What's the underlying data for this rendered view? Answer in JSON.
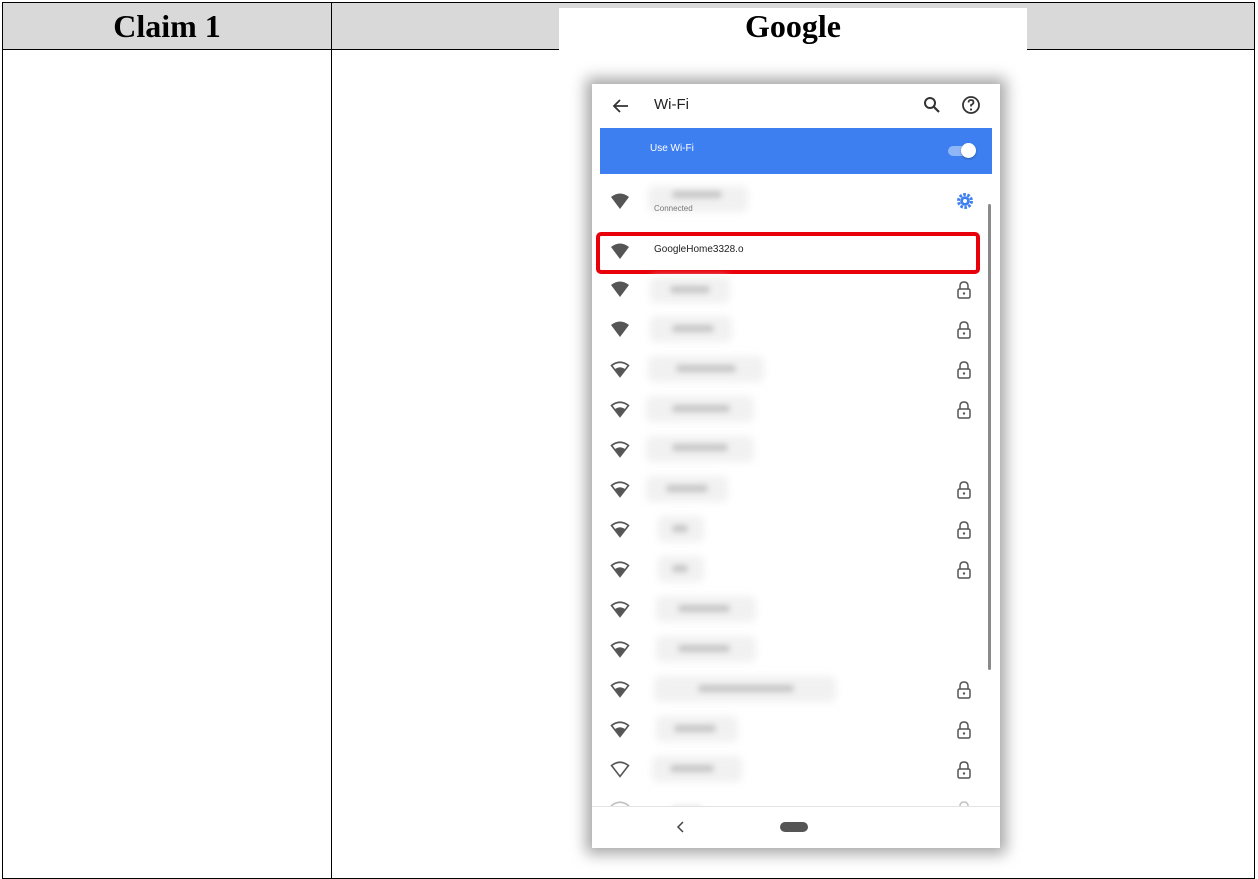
{
  "table": {
    "header_left": "Claim 1",
    "header_right": "Google"
  },
  "phone": {
    "appbar": {
      "title": "Wi-Fi",
      "icons": [
        "back-arrow-icon",
        "search-icon",
        "help-icon"
      ]
    },
    "switch": {
      "label": "Use Wi-Fi",
      "state": "on",
      "color": "#3d7ff0"
    },
    "networks": [
      {
        "name": "",
        "status": "Connected",
        "signal": "full",
        "secured": false,
        "blurred": true,
        "trailing_icon": "gear-icon"
      },
      {
        "name": "GoogleHome3328.o",
        "status": "",
        "signal": "full",
        "secured": false,
        "blurred": false,
        "highlighted": true
      },
      {
        "name": "",
        "signal": "full",
        "secured": true,
        "blurred": true
      },
      {
        "name": "",
        "signal": "full",
        "secured": true,
        "blurred": true
      },
      {
        "name": "",
        "signal": "outline",
        "secured": true,
        "blurred": true
      },
      {
        "name": "",
        "signal": "outline",
        "secured": true,
        "blurred": true
      },
      {
        "name": "",
        "signal": "outline",
        "secured": false,
        "blurred": true
      },
      {
        "name": "",
        "signal": "outline",
        "secured": true,
        "blurred": true
      },
      {
        "name": "",
        "signal": "outline",
        "secured": true,
        "blurred": true
      },
      {
        "name": "",
        "signal": "outline",
        "secured": true,
        "blurred": true
      },
      {
        "name": "",
        "signal": "outline",
        "secured": false,
        "blurred": true
      },
      {
        "name": "",
        "signal": "outline",
        "secured": false,
        "blurred": true
      },
      {
        "name": "",
        "signal": "outline",
        "secured": true,
        "blurred": true
      },
      {
        "name": "",
        "signal": "outline",
        "secured": true,
        "blurred": true
      },
      {
        "name": "",
        "signal": "outline",
        "secured": true,
        "blurred": true
      },
      {
        "name": "",
        "signal": "outline",
        "secured": true,
        "blurred": true,
        "partial": true
      }
    ],
    "highlight_color": "#e8000b",
    "navbar_icons": [
      "nav-back-icon",
      "home-pill-icon"
    ]
  }
}
